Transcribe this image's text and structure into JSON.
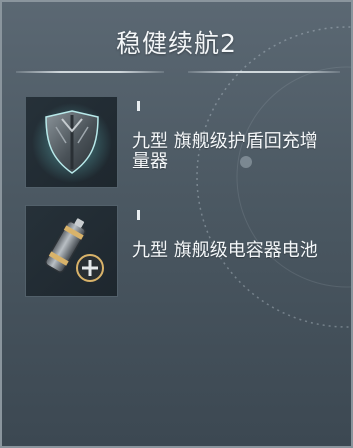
{
  "panel": {
    "title": "稳健续航2"
  },
  "items": [
    {
      "tier": "I",
      "name": "九型 旗舰级护盾回充增量器",
      "icon": "shield-icon"
    },
    {
      "tier": "I",
      "name": "九型 旗舰级电容器电池",
      "icon": "capacitor-battery-icon"
    }
  ],
  "colors": {
    "panel_top": "#5b6873",
    "panel_bottom": "#3c4852",
    "icon_bg": "#232d34",
    "text": "#f1f4f6",
    "shield_glow": "#6fd6d8",
    "battery_accent": "#d9b36a"
  }
}
